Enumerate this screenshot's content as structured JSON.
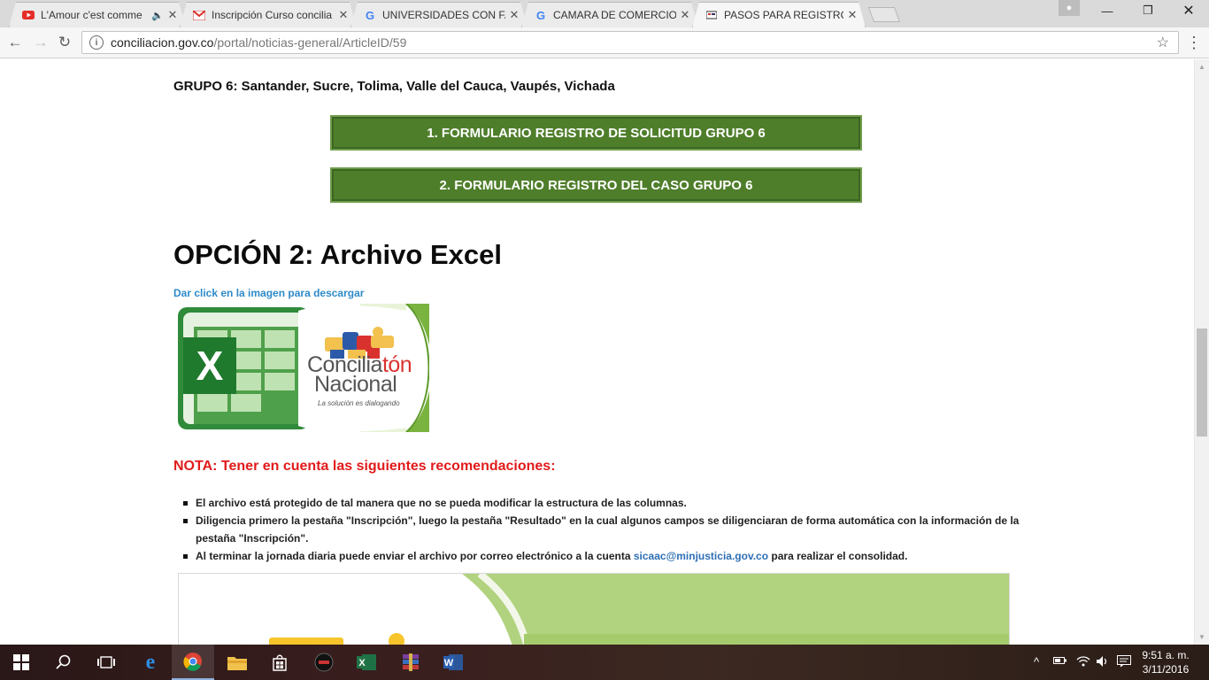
{
  "browser": {
    "tabs": [
      {
        "title": "L'Amour c'est comme",
        "favicon": "youtube-icon",
        "has_audio": true
      },
      {
        "title": "Inscripción Curso concilia",
        "favicon": "gmail-icon"
      },
      {
        "title": "UNIVERSIDADES CON FA",
        "favicon": "google-icon"
      },
      {
        "title": "CAMARA DE COMERCIO",
        "favicon": "google-icon"
      },
      {
        "title": "PASOS PARA REGISTRO D",
        "favicon": "site-icon",
        "active": true
      }
    ],
    "url_host": "conciliacion.gov.co",
    "url_path": "/portal/noticias-general/ArticleID/59"
  },
  "page": {
    "grupo_heading": "GRUPO 6: Santander, Sucre, Tolima, Valle del Cauca, Vaupés, Vichada",
    "button1_label": "1. FORMULARIO REGISTRO DE SOLICITUD GRUPO 6",
    "button2_label": "2. FORMULARIO REGISTRO DEL CASO GRUPO 6",
    "option_heading": "OPCIÓN 2: Archivo Excel",
    "download_hint": "Dar click en la imagen para descargar",
    "logo_text_line1": "Concilia",
    "logo_text_line1_accent": "tón",
    "logo_text_line2": "Nacional",
    "logo_tagline": "La solución es dialogando",
    "nota": "NOTA: Tener en cuenta las siguientes recomendaciones:",
    "recommendations": [
      "El archivo está protegido de tal manera que no se pueda modificar la estructura de las columnas.",
      "Diligencia primero la pestaña \"Inscripción\", luego la pestaña \"Resultado\" en la cual algunos campos se diligenciaran de forma automática con la información de la pestaña \"Inscripción\"."
    ],
    "rec3_before": "Al terminar la jornada diaria puede enviar el archivo por correo electrónico a la cuenta",
    "rec3_email": "sicaac@minjusticia.gov.co",
    "rec3_after": "para realizar el consolidad."
  },
  "taskbar": {
    "time": "9:51 a. m.",
    "date": "3/11/2016"
  },
  "colors": {
    "green_button": "#4f7e2b",
    "nota_red": "#e21b1b",
    "link_blue": "#2e8bc9"
  }
}
